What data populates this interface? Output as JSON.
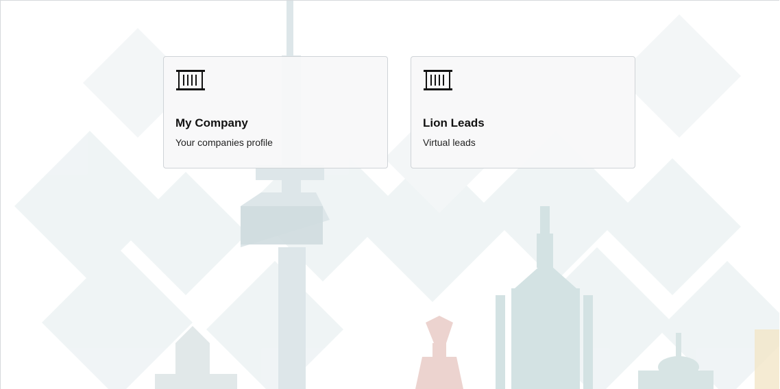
{
  "cards": [
    {
      "icon": "building-columns-icon",
      "title": "My Company",
      "subtitle": "Your companies profile"
    },
    {
      "icon": "building-columns-icon",
      "title": "Lion Leads",
      "subtitle": "Virtual leads"
    }
  ],
  "colors": {
    "card_background": "#f8f8f9",
    "card_border": "#cfd3d7",
    "title_text": "#111111",
    "background_tint_blue": "#c9dadf",
    "background_tint_red": "#e8c4bf"
  }
}
